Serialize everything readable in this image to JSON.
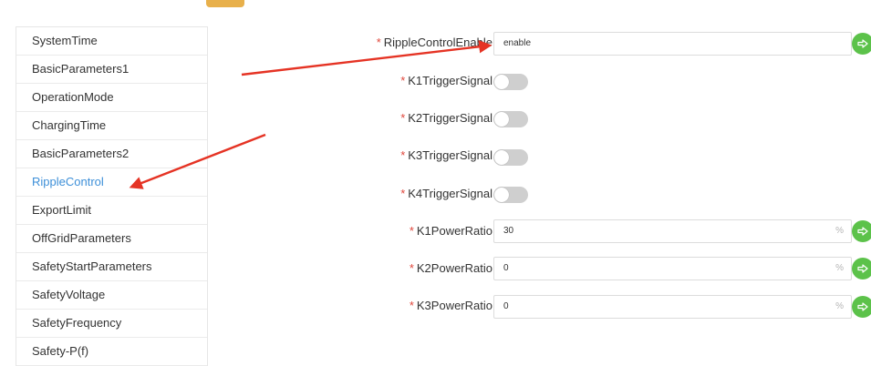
{
  "sidebar": {
    "items": [
      {
        "label": "SystemTime"
      },
      {
        "label": "BasicParameters1"
      },
      {
        "label": "OperationMode"
      },
      {
        "label": "ChargingTime"
      },
      {
        "label": "BasicParameters2"
      },
      {
        "label": "RippleControl",
        "active": true
      },
      {
        "label": "ExportLimit"
      },
      {
        "label": "OffGridParameters"
      },
      {
        "label": "SafetyStartParameters"
      },
      {
        "label": "SafetyVoltage"
      },
      {
        "label": "SafetyFrequency"
      },
      {
        "label": "Safety-P(f)"
      }
    ]
  },
  "form": {
    "required_mark": "*",
    "ripple_enable": {
      "label": "RippleControlEnable",
      "value": "enable"
    },
    "k1_trigger": {
      "label": "K1TriggerSignal",
      "on": false
    },
    "k2_trigger": {
      "label": "K2TriggerSignal",
      "on": false
    },
    "k3_trigger": {
      "label": "K3TriggerSignal",
      "on": false
    },
    "k4_trigger": {
      "label": "K4TriggerSignal",
      "on": false
    },
    "k1_power": {
      "label": "K1PowerRatio",
      "value": "30",
      "unit": "%"
    },
    "k2_power": {
      "label": "K2PowerRatio",
      "value": "0",
      "unit": "%"
    },
    "k3_power": {
      "label": "K3PowerRatio",
      "value": "0",
      "unit": "%"
    }
  },
  "icons": {
    "send": "send-arrow-icon"
  },
  "colors": {
    "accent_blue": "#3d8fd8",
    "required_red": "#e0473c",
    "send_green": "#5cc24a",
    "annotation_red": "#e53324",
    "top_accent": "#e8b04b"
  }
}
